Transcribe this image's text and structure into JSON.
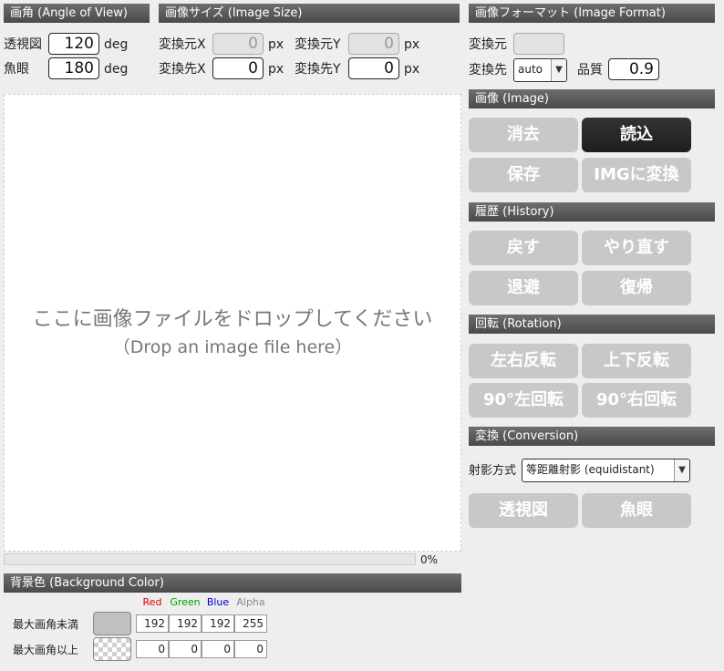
{
  "angle": {
    "header": "画角 (Angle of View)",
    "perspective_label": "透視図",
    "perspective_value": "120",
    "fisheye_label": "魚眼",
    "fisheye_value": "180",
    "unit": "deg"
  },
  "image_size": {
    "header": "画像サイズ (Image Size)",
    "src_x_label": "変換元X",
    "src_x_value": "0",
    "src_y_label": "変換元Y",
    "src_y_value": "0",
    "dst_x_label": "変換先X",
    "dst_x_value": "0",
    "dst_y_label": "変換先Y",
    "dst_y_value": "0",
    "unit": "px"
  },
  "format": {
    "header": "画像フォーマット (Image Format)",
    "src_label": "変換元",
    "src_value": "",
    "dst_label": "変換先",
    "dst_value": "auto",
    "quality_label": "品質",
    "quality_value": "0.9"
  },
  "image": {
    "header": "画像 (Image)",
    "clear": "消去",
    "load": "読込",
    "save": "保存",
    "to_img": "IMGに変換"
  },
  "history": {
    "header": "履歴 (History)",
    "undo": "戻す",
    "redo": "やり直す",
    "stash": "退避",
    "restore": "復帰"
  },
  "rotation": {
    "header": "回転 (Rotation)",
    "flip_h": "左右反転",
    "flip_v": "上下反転",
    "rot_left": "90°左回転",
    "rot_right": "90°右回転"
  },
  "conversion": {
    "header": "変換 (Conversion)",
    "projection_label": "射影方式",
    "projection_value": "等距離射影 (equidistant)",
    "to_perspective": "透視図",
    "to_fisheye": "魚眼"
  },
  "drop": {
    "line1": "ここに画像ファイルをドロップしてください",
    "line2": "（Drop an image file here）"
  },
  "progress": {
    "text": "0%",
    "fraction": 0
  },
  "background": {
    "header": "背景色 (Background Color)",
    "channels": [
      "Red",
      "Green",
      "Blue",
      "Alpha"
    ],
    "row1_label": "最大画角未満",
    "row1_values": [
      "192",
      "192",
      "192",
      "255"
    ],
    "row2_label": "最大画角以上",
    "row2_values": [
      "0",
      "0",
      "0",
      "0"
    ]
  },
  "colors": {
    "red": "#e00000",
    "green": "#00a000",
    "blue": "#0000d0",
    "alpha": "#888888",
    "swatch1": "#c0c0c0"
  }
}
